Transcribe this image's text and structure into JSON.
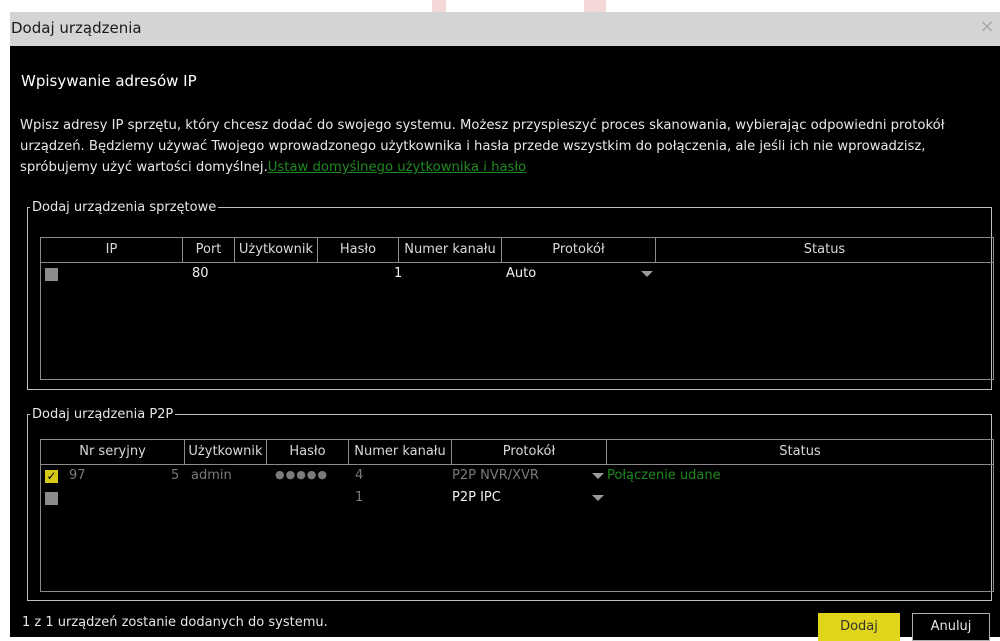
{
  "dialog": {
    "title": "Dodaj urządzenia",
    "close_icon": "×",
    "heading": "Wpisywanie adresów IP",
    "description": "Wpisz adresy IP sprzętu, który chcesz dodać do swojego systemu. Możesz przyspieszyć proces skanowania, wybierając odpowiedni protokół urządzeń. Będziemy używać Twojego wprowadzonego użytkownika i hasła przede wszystkim do połączenia, ale jeśli ich nie wprowadzisz, spróbujemy użyć wartości domyślnej.",
    "default_link": "Ustaw domyślnego użytkownika i hasło"
  },
  "hardware_group": {
    "legend": "Dodaj urządzenia sprzętowe",
    "columns": [
      "IP",
      "Port",
      "Użytkownik",
      "Hasło",
      "Numer kanału",
      "Protokół",
      "Status"
    ],
    "rows": [
      {
        "checked": false,
        "ip": "",
        "port": "80",
        "user": "",
        "password": "",
        "channel": "1",
        "protocol": "Auto",
        "status": ""
      }
    ]
  },
  "p2p_group": {
    "legend": "Dodaj urządzenia P2P",
    "columns": [
      "Nr seryjny",
      "Użytkownik",
      "Hasło",
      "Numer kanału",
      "Protokół",
      "Status"
    ],
    "rows": [
      {
        "checked": true,
        "serial_prefix": "97",
        "serial_suffix": "5",
        "user": "admin",
        "password": "●●●●●",
        "channel": "4",
        "protocol": "P2P NVR/XVR",
        "status": "Połączenie udane"
      },
      {
        "checked": false,
        "serial_prefix": "",
        "serial_suffix": "",
        "user": "",
        "password": "",
        "channel": "1",
        "protocol": "P2P IPC",
        "status": ""
      }
    ]
  },
  "footer": {
    "summary": "1 z 1 urządzeń zostanie dodanych do systemu.",
    "add_label": "Dodaj",
    "cancel_label": "Anuluj"
  },
  "colors": {
    "accent_yellow": "#e0d51a",
    "success_green": "#1f8a1f",
    "background": "#000000",
    "titlebar": "#d4d4d4"
  }
}
